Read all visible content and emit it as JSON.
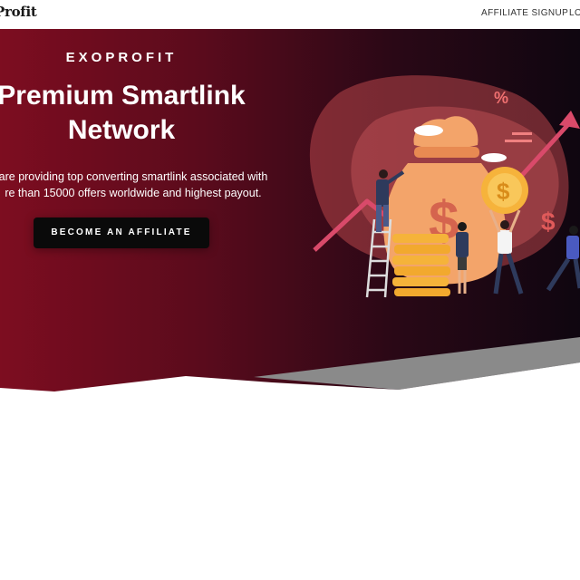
{
  "nav": {
    "logo_text": "Profit",
    "links": [
      "AFFILIATE SIGNUP",
      "LO"
    ]
  },
  "hero": {
    "brand": "EXOPROFIT",
    "headline_line1": "Premium Smartlink",
    "headline_line2": "Network",
    "description_line1": "are providing top converting smartlink associated with",
    "description_line2": "re than 15000 offers worldwide and highest payout.",
    "cta_label": "BECOME AN AFFILIATE"
  },
  "illustration": {
    "percent_symbol": "%",
    "dollar_symbol": "$"
  },
  "colors": {
    "hero_start": "#7d0d20",
    "hero_end": "#0f0610",
    "accent_orange": "#f0a060",
    "button_bg": "#0a0a0a"
  }
}
